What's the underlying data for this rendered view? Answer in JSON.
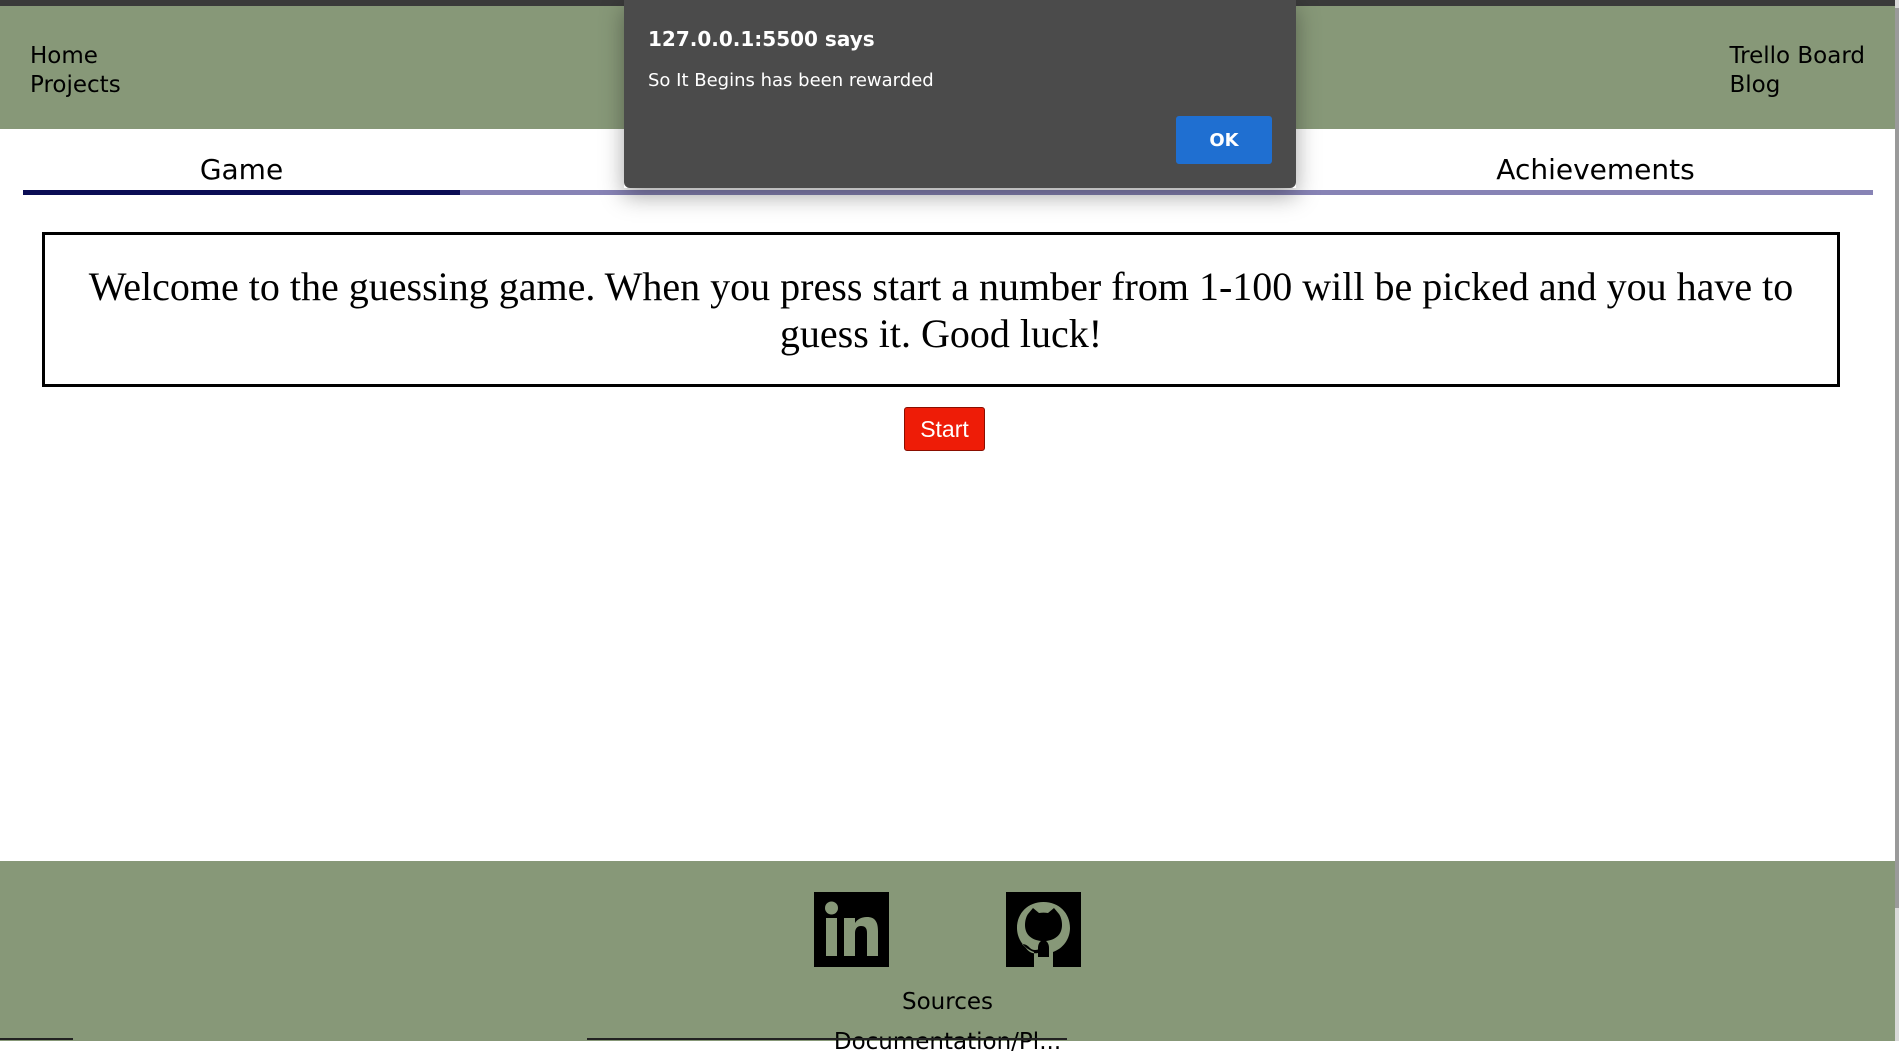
{
  "header": {
    "left_links": [
      {
        "label": "Home"
      },
      {
        "label": "Projects"
      }
    ],
    "right_links": [
      {
        "label": "Trello Board"
      },
      {
        "label": "Blog"
      }
    ],
    "background_color": "#879878"
  },
  "tabs": [
    {
      "label": "Game",
      "active": true
    },
    {
      "label": "",
      "active": false
    },
    {
      "label": "",
      "active": false
    },
    {
      "label": "Achievements",
      "active": false
    }
  ],
  "main": {
    "welcome_text": "Welcome to the guessing game. When you press start a number from 1-100 will be picked and you have to guess it. Good luck!",
    "start_label": "Start",
    "start_color": "#ee1c07"
  },
  "footer": {
    "icons": [
      "linkedin-icon",
      "github-icon"
    ],
    "sources_label": "Sources",
    "doc_label": "Documentation/Pl..."
  },
  "dialog": {
    "title": "127.0.0.1:5500 says",
    "message": "So It Begins has been rewarded",
    "ok_label": "OK",
    "ok_color": "#1f6fd1"
  }
}
